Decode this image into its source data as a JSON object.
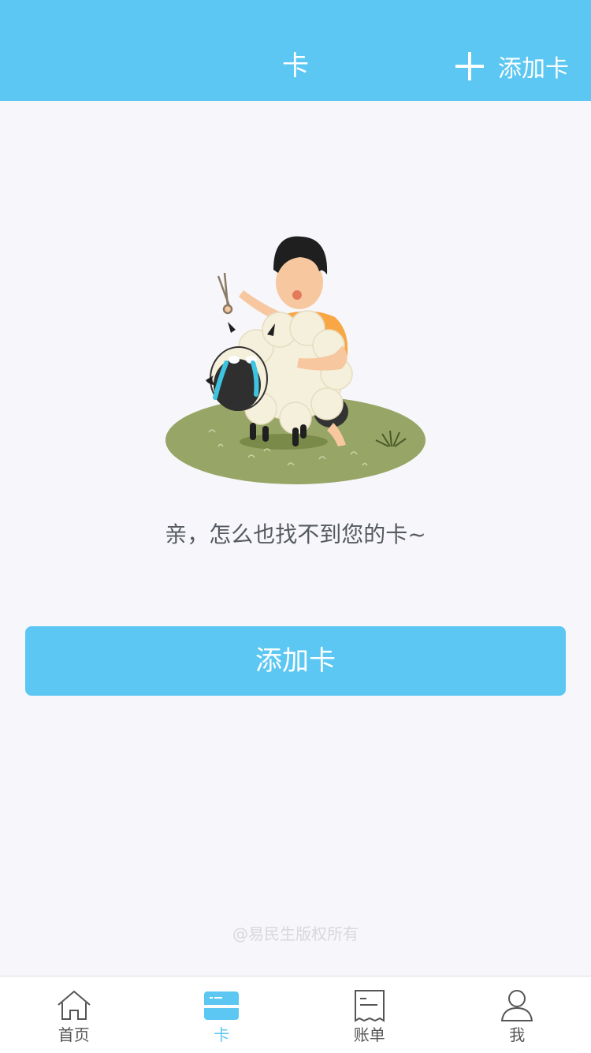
{
  "header": {
    "title": "卡",
    "add_label": "添加卡",
    "add_icon": "plus-icon"
  },
  "colors": {
    "accent": "#5bc7f2",
    "background": "#f7f7fb",
    "text_muted": "#555a60"
  },
  "empty_state": {
    "illustration": "boy-shearing-sheep",
    "message": "亲，怎么也找不到您的卡~"
  },
  "primary_button": {
    "label": "添加卡"
  },
  "footer": {
    "copyright": "@易民生版权所有"
  },
  "tabbar": {
    "active": "卡",
    "items": [
      {
        "label": "首页",
        "icon": "home-icon"
      },
      {
        "label": "卡",
        "icon": "card-icon"
      },
      {
        "label": "账单",
        "icon": "bill-icon"
      },
      {
        "label": "我",
        "icon": "person-icon"
      }
    ]
  }
}
